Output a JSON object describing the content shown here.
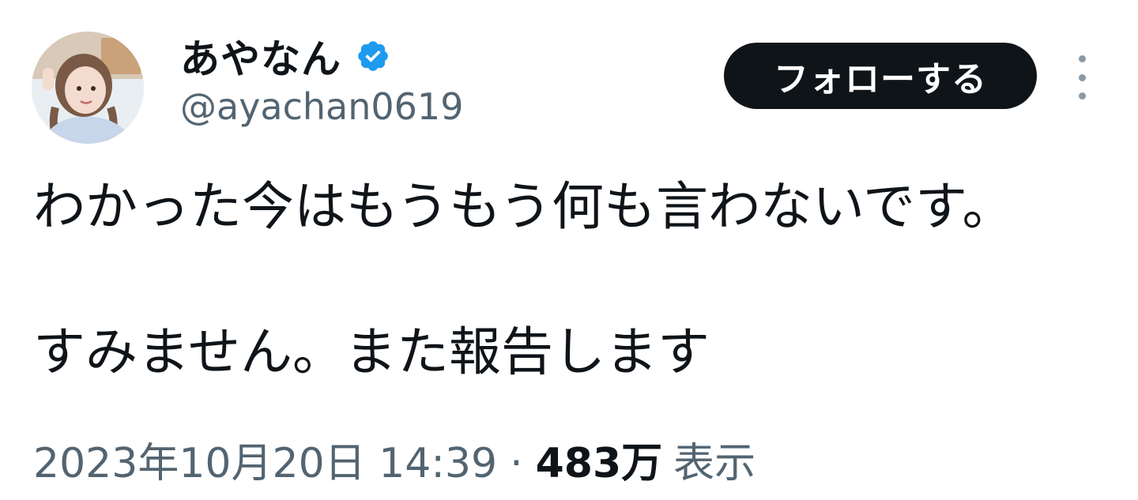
{
  "user": {
    "display_name": "あやなん",
    "handle": "@ayachan0619",
    "verified_icon": "verified-badge-icon",
    "verified_color": "#1d9bf0"
  },
  "actions": {
    "follow_label": "フォローする",
    "more_icon": "more-vertical-icon"
  },
  "tweet": {
    "lines": [
      "わかった今はもうもう何も言わないです。",
      "すみません。また報告します"
    ]
  },
  "meta": {
    "timestamp": "2023年10月20日 14:39",
    "separator": "·",
    "views_count": "483万",
    "views_label": "表示"
  },
  "colors": {
    "text_primary": "#0f1419",
    "text_secondary": "#536471",
    "button_bg": "#0f1419",
    "button_text": "#ffffff"
  }
}
